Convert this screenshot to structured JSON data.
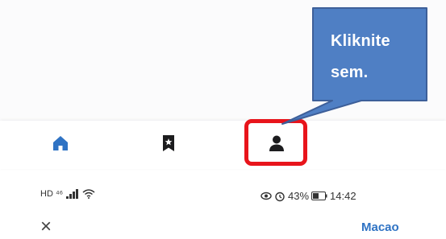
{
  "callout": {
    "line1": "Kliknite",
    "line2": "sem.",
    "fill_color": "#4f7fc4",
    "border_color": "#3d5f99"
  },
  "nav": {
    "items": [
      {
        "icon": "home-icon",
        "active": true
      },
      {
        "icon": "bookmark-icon",
        "active": false
      },
      {
        "icon": "profile-icon",
        "active": false,
        "highlighted": true
      }
    ],
    "active_color": "#2f73c4",
    "icon_color": "#1c1c1e",
    "highlight_color": "#e8141b"
  },
  "status_bar": {
    "network": "HD ⁴⁶",
    "battery_percent": "43%",
    "time": "14:42"
  },
  "header": {
    "close_symbol": "×",
    "location_label": "Macao"
  }
}
